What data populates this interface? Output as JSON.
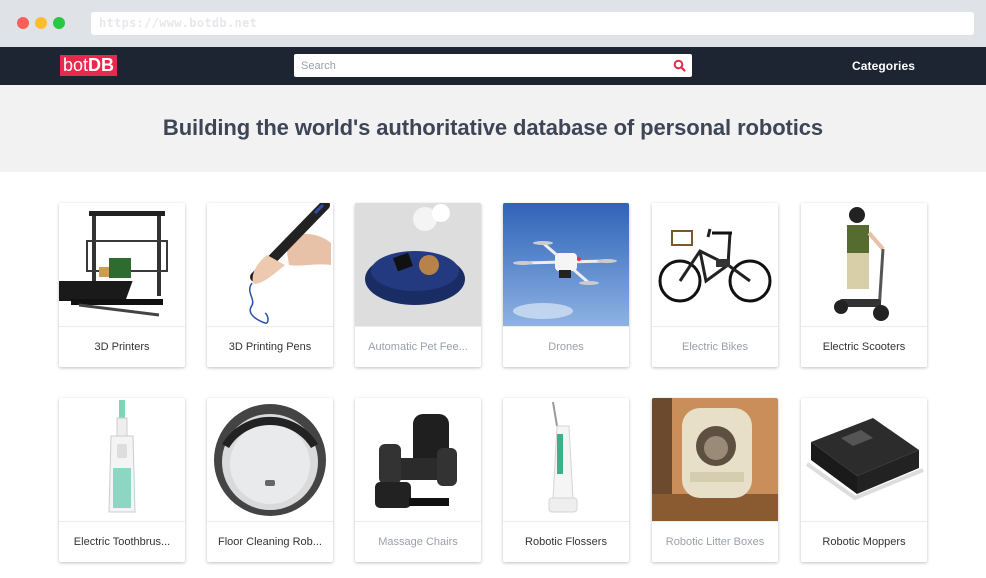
{
  "browser": {
    "url": "https://www.botdb.net"
  },
  "navbar": {
    "logo_prefix": "bot",
    "logo_suffix": "DB",
    "search_placeholder": "Search",
    "categories_label": "Categories"
  },
  "hero": {
    "headline": "Building the world's authoritative database of personal robotics"
  },
  "categories": [
    {
      "label": "3D Printers",
      "muted": true,
      "icon": "3d-printer"
    },
    {
      "label": "3D Printing Pens",
      "muted": true,
      "icon": "3d-pen"
    },
    {
      "label": "Automatic Pet Fee...",
      "muted": true,
      "icon": "pet-feeder"
    },
    {
      "label": "Drones",
      "muted": true,
      "icon": "drone"
    },
    {
      "label": "Electric Bikes",
      "muted": true,
      "icon": "bicycle"
    },
    {
      "label": "Electric Scooters",
      "muted": false,
      "icon": "scooter"
    },
    {
      "label": "Electric Toothbrus...",
      "muted": false,
      "icon": "toothbrush"
    },
    {
      "label": "Floor Cleaning Rob...",
      "muted": false,
      "icon": "robot-vacuum"
    },
    {
      "label": "Massage Chairs",
      "muted": true,
      "icon": "massage-chair"
    },
    {
      "label": "Robotic Flossers",
      "muted": false,
      "icon": "flosser"
    },
    {
      "label": "Robotic Litter Boxes",
      "muted": true,
      "icon": "litter-box"
    },
    {
      "label": "Robotic Moppers",
      "muted": false,
      "icon": "mopper"
    }
  ],
  "colors": {
    "brand": "#e8284c",
    "navbar": "#1e2532",
    "hero_bg": "#f2f2f2",
    "headline": "#3d4556"
  }
}
